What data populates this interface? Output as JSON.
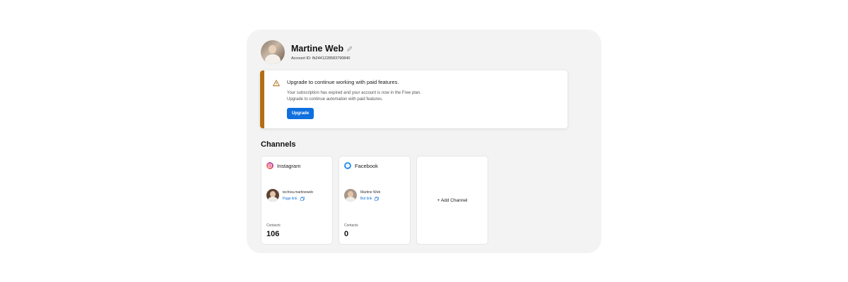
{
  "profile": {
    "name": "Martine Web",
    "account_id": "Account ID: fb2441228583790840"
  },
  "banner": {
    "title": "Upgrade to continue working with paid features.",
    "desc_line1": "Your subscription has expired and your account is now in the Free plan.",
    "desc_line2": "Upgrade to continue automation with paid features.",
    "button": "Upgrade",
    "accent": "#b36d12",
    "button_color": "#0f6fde"
  },
  "channels": {
    "title": "Channels",
    "instagram": {
      "name": "Instagram",
      "icon": "instagram-icon",
      "account": "techiva.martineweb",
      "link": "Page link",
      "contacts_label": "Contacts",
      "contacts": "106"
    },
    "facebook": {
      "name": "Facebook",
      "icon": "messenger-icon",
      "account": "Martine Web",
      "link": "Bot link",
      "contacts_label": "Contacts",
      "contacts": "0"
    },
    "add": "+ Add Channel"
  }
}
